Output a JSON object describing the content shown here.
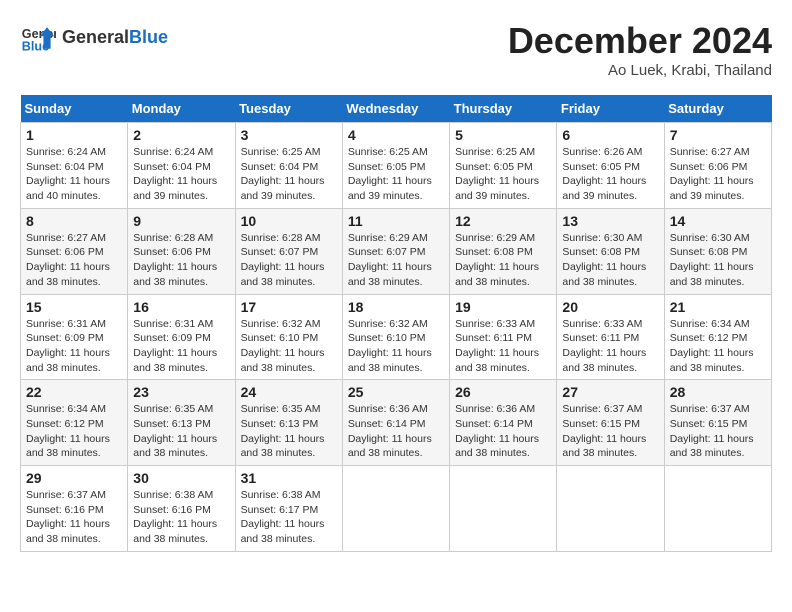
{
  "header": {
    "logo_general": "General",
    "logo_blue": "Blue",
    "title": "December 2024",
    "location": "Ao Luek, Krabi, Thailand"
  },
  "calendar": {
    "days_of_week": [
      "Sunday",
      "Monday",
      "Tuesday",
      "Wednesday",
      "Thursday",
      "Friday",
      "Saturday"
    ],
    "weeks": [
      [
        {
          "day": "",
          "info": ""
        },
        {
          "day": "2",
          "info": "Sunrise: 6:24 AM\nSunset: 6:04 PM\nDaylight: 11 hours\nand 39 minutes."
        },
        {
          "day": "3",
          "info": "Sunrise: 6:25 AM\nSunset: 6:04 PM\nDaylight: 11 hours\nand 39 minutes."
        },
        {
          "day": "4",
          "info": "Sunrise: 6:25 AM\nSunset: 6:05 PM\nDaylight: 11 hours\nand 39 minutes."
        },
        {
          "day": "5",
          "info": "Sunrise: 6:25 AM\nSunset: 6:05 PM\nDaylight: 11 hours\nand 39 minutes."
        },
        {
          "day": "6",
          "info": "Sunrise: 6:26 AM\nSunset: 6:05 PM\nDaylight: 11 hours\nand 39 minutes."
        },
        {
          "day": "7",
          "info": "Sunrise: 6:27 AM\nSunset: 6:06 PM\nDaylight: 11 hours\nand 39 minutes."
        }
      ],
      [
        {
          "day": "1",
          "info": "Sunrise: 6:24 AM\nSunset: 6:04 PM\nDaylight: 11 hours\nand 40 minutes."
        },
        {
          "day": "8",
          "info": ""
        },
        {
          "day": "9",
          "info": "Sunrise: 6:28 AM\nSunset: 6:06 PM\nDaylight: 11 hours\nand 38 minutes."
        },
        {
          "day": "10",
          "info": "Sunrise: 6:28 AM\nSunset: 6:07 PM\nDaylight: 11 hours\nand 38 minutes."
        },
        {
          "day": "11",
          "info": "Sunrise: 6:29 AM\nSunset: 6:07 PM\nDaylight: 11 hours\nand 38 minutes."
        },
        {
          "day": "12",
          "info": "Sunrise: 6:29 AM\nSunset: 6:08 PM\nDaylight: 11 hours\nand 38 minutes."
        },
        {
          "day": "13",
          "info": "Sunrise: 6:30 AM\nSunset: 6:08 PM\nDaylight: 11 hours\nand 38 minutes."
        },
        {
          "day": "14",
          "info": "Sunrise: 6:30 AM\nSunset: 6:08 PM\nDaylight: 11 hours\nand 38 minutes."
        }
      ],
      [
        {
          "day": "15",
          "info": "Sunrise: 6:31 AM\nSunset: 6:09 PM\nDaylight: 11 hours\nand 38 minutes."
        },
        {
          "day": "16",
          "info": "Sunrise: 6:31 AM\nSunset: 6:09 PM\nDaylight: 11 hours\nand 38 minutes."
        },
        {
          "day": "17",
          "info": "Sunrise: 6:32 AM\nSunset: 6:10 PM\nDaylight: 11 hours\nand 38 minutes."
        },
        {
          "day": "18",
          "info": "Sunrise: 6:32 AM\nSunset: 6:10 PM\nDaylight: 11 hours\nand 38 minutes."
        },
        {
          "day": "19",
          "info": "Sunrise: 6:33 AM\nSunset: 6:11 PM\nDaylight: 11 hours\nand 38 minutes."
        },
        {
          "day": "20",
          "info": "Sunrise: 6:33 AM\nSunset: 6:11 PM\nDaylight: 11 hours\nand 38 minutes."
        },
        {
          "day": "21",
          "info": "Sunrise: 6:34 AM\nSunset: 6:12 PM\nDaylight: 11 hours\nand 38 minutes."
        }
      ],
      [
        {
          "day": "22",
          "info": "Sunrise: 6:34 AM\nSunset: 6:12 PM\nDaylight: 11 hours\nand 38 minutes."
        },
        {
          "day": "23",
          "info": "Sunrise: 6:35 AM\nSunset: 6:13 PM\nDaylight: 11 hours\nand 38 minutes."
        },
        {
          "day": "24",
          "info": "Sunrise: 6:35 AM\nSunset: 6:13 PM\nDaylight: 11 hours\nand 38 minutes."
        },
        {
          "day": "25",
          "info": "Sunrise: 6:36 AM\nSunset: 6:14 PM\nDaylight: 11 hours\nand 38 minutes."
        },
        {
          "day": "26",
          "info": "Sunrise: 6:36 AM\nSunset: 6:14 PM\nDaylight: 11 hours\nand 38 minutes."
        },
        {
          "day": "27",
          "info": "Sunrise: 6:37 AM\nSunset: 6:15 PM\nDaylight: 11 hours\nand 38 minutes."
        },
        {
          "day": "28",
          "info": "Sunrise: 6:37 AM\nSunset: 6:15 PM\nDaylight: 11 hours\nand 38 minutes."
        }
      ],
      [
        {
          "day": "29",
          "info": "Sunrise: 6:37 AM\nSunset: 6:16 PM\nDaylight: 11 hours\nand 38 minutes."
        },
        {
          "day": "30",
          "info": "Sunrise: 6:38 AM\nSunset: 6:16 PM\nDaylight: 11 hours\nand 38 minutes."
        },
        {
          "day": "31",
          "info": "Sunrise: 6:38 AM\nSunset: 6:17 PM\nDaylight: 11 hours\nand 38 minutes."
        },
        {
          "day": "",
          "info": ""
        },
        {
          "day": "",
          "info": ""
        },
        {
          "day": "",
          "info": ""
        },
        {
          "day": "",
          "info": ""
        }
      ]
    ]
  }
}
